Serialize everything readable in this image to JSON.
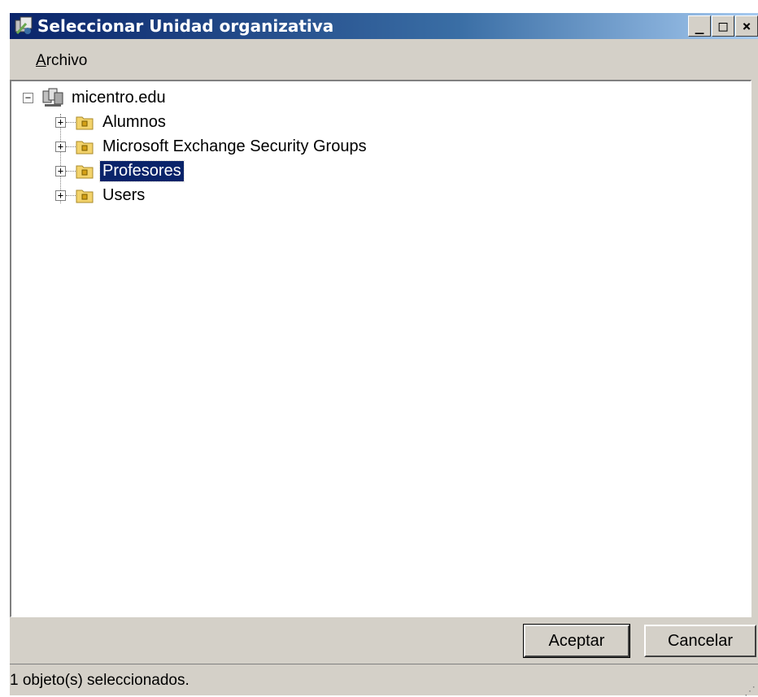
{
  "window": {
    "title": "Seleccionar Unidad organizativa",
    "controls": {
      "minimize": "_",
      "maximize": "□",
      "close": "×"
    }
  },
  "menu": {
    "archivo_accel": "A",
    "archivo_rest": "rchivo"
  },
  "tree": {
    "root": {
      "label": "micentro.edu",
      "icon": "domain-icon",
      "expander": "−"
    },
    "children": [
      {
        "label": "Alumnos",
        "icon": "ou-folder-icon",
        "expander": "+"
      },
      {
        "label": "Microsoft Exchange Security Groups",
        "icon": "ou-folder-icon",
        "expander": "+"
      },
      {
        "label": "Profesores",
        "icon": "ou-folder-icon",
        "expander": "+",
        "selected": true
      },
      {
        "label": "Users",
        "icon": "ou-folder-icon",
        "expander": "+"
      }
    ]
  },
  "buttons": {
    "accept": "Aceptar",
    "cancel": "Cancelar"
  },
  "status": {
    "text": "1 objeto(s) seleccionados."
  },
  "colors": {
    "title_gradient_start": "#0a246a",
    "selection": "#0a246a",
    "face": "#d4d0c8"
  }
}
